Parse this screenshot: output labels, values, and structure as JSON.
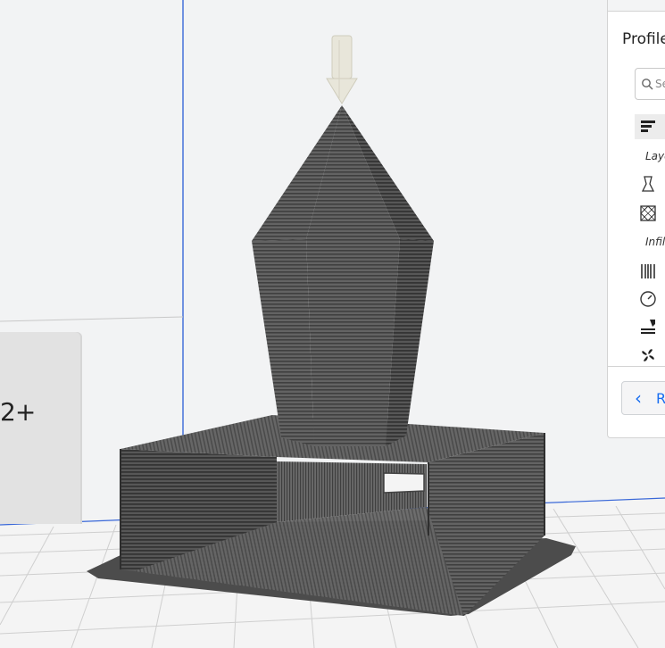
{
  "viewport": {
    "side_box_label": "2+",
    "model_color": "#5a5a5a",
    "nozzle_color": "#e8e6da",
    "axis_color": "#3a68d8"
  },
  "panel": {
    "title": "Profile",
    "search_placeholder": "Se",
    "sections": [
      {
        "label": "Laye"
      },
      {
        "label": "Infill"
      }
    ],
    "back_label": "R"
  }
}
